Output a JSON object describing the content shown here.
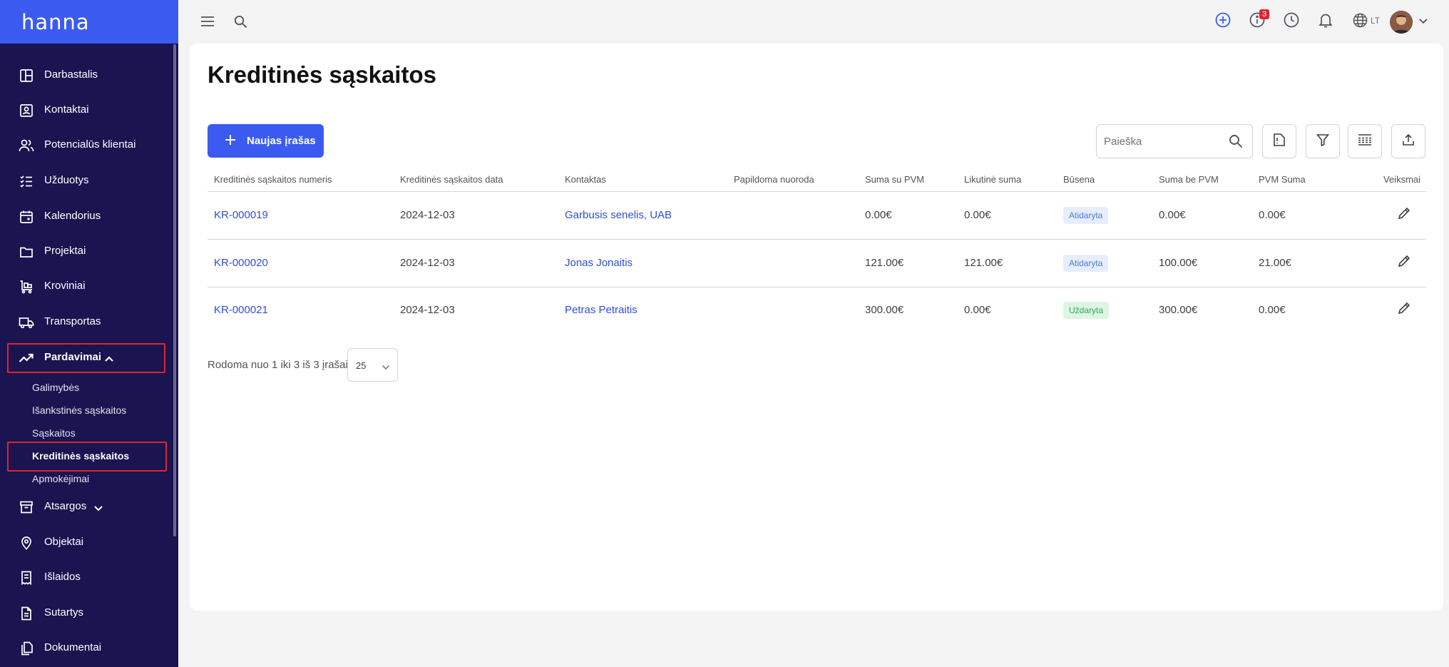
{
  "app": {
    "logo": "hanna"
  },
  "sidebar": {
    "items": [
      {
        "label": "Darbastalis",
        "icon": "dashboard-icon"
      },
      {
        "label": "Kontaktai",
        "icon": "contact-card-icon"
      },
      {
        "label": "Potencialūs klientai",
        "icon": "users-icon"
      },
      {
        "label": "Užduotys",
        "icon": "checklist-icon"
      },
      {
        "label": "Kalendorius",
        "icon": "calendar-icon"
      },
      {
        "label": "Projektai",
        "icon": "folder-icon"
      },
      {
        "label": "Kroviniai",
        "icon": "cart-icon"
      },
      {
        "label": "Transportas",
        "icon": "truck-icon"
      },
      {
        "label": "Pardavimai",
        "icon": "trending-up-icon"
      },
      {
        "label": "Atsargos",
        "icon": "archive-icon"
      },
      {
        "label": "Objektai",
        "icon": "map-pin-icon"
      },
      {
        "label": "Išlaidos",
        "icon": "receipt-icon"
      },
      {
        "label": "Sutartys",
        "icon": "document-icon"
      },
      {
        "label": "Dokumentai",
        "icon": "documents-icon"
      }
    ],
    "sales_sub": [
      {
        "label": "Galimybės"
      },
      {
        "label": "Išankstinės sąskaitos"
      },
      {
        "label": "Sąskaitos"
      },
      {
        "label": "Kreditinės sąskaitos"
      },
      {
        "label": "Apmokėjimai"
      }
    ]
  },
  "topbar": {
    "notifications_count": "3",
    "language": "LT"
  },
  "page": {
    "title": "Kreditinės sąskaitos",
    "new_button": "Naujas įrašas",
    "search_placeholder": "Paieška"
  },
  "table": {
    "columns": [
      "Kreditinės sąskaitos numeris",
      "Kreditinės sąskaitos data",
      "Kontaktas",
      "Papildoma nuoroda",
      "Suma su PVM",
      "Likutinė suma",
      "Būsena",
      "Suma be PVM",
      "PVM Suma",
      "Veiksmai"
    ],
    "rows": [
      {
        "number": "KR-000019",
        "date": "2024-12-03",
        "contact": "Garbusis senelis, UAB",
        "reference": "",
        "total_vat": "0.00€",
        "remaining": "0.00€",
        "status": "Atidaryta",
        "status_type": "open",
        "total_no_vat": "0.00€",
        "vat": "0.00€"
      },
      {
        "number": "KR-000020",
        "date": "2024-12-03",
        "contact": "Jonas Jonaitis",
        "reference": "",
        "total_vat": "121.00€",
        "remaining": "121.00€",
        "status": "Atidaryta",
        "status_type": "open",
        "total_no_vat": "100.00€",
        "vat": "21.00€"
      },
      {
        "number": "KR-000021",
        "date": "2024-12-03",
        "contact": "Petras Petraitis",
        "reference": "",
        "total_vat": "300.00€",
        "remaining": "0.00€",
        "status": "Uždaryta",
        "status_type": "closed",
        "total_no_vat": "300.00€",
        "vat": "0.00€"
      }
    ]
  },
  "pagination": {
    "summary": "Rodoma nuo 1 iki 3 iš 3 įrašai",
    "page_size": "25"
  },
  "colors": {
    "primary": "#3b5bf0",
    "sidebar": "#1a1450",
    "highlight": "#e0242e",
    "link": "#2f4fd8"
  }
}
